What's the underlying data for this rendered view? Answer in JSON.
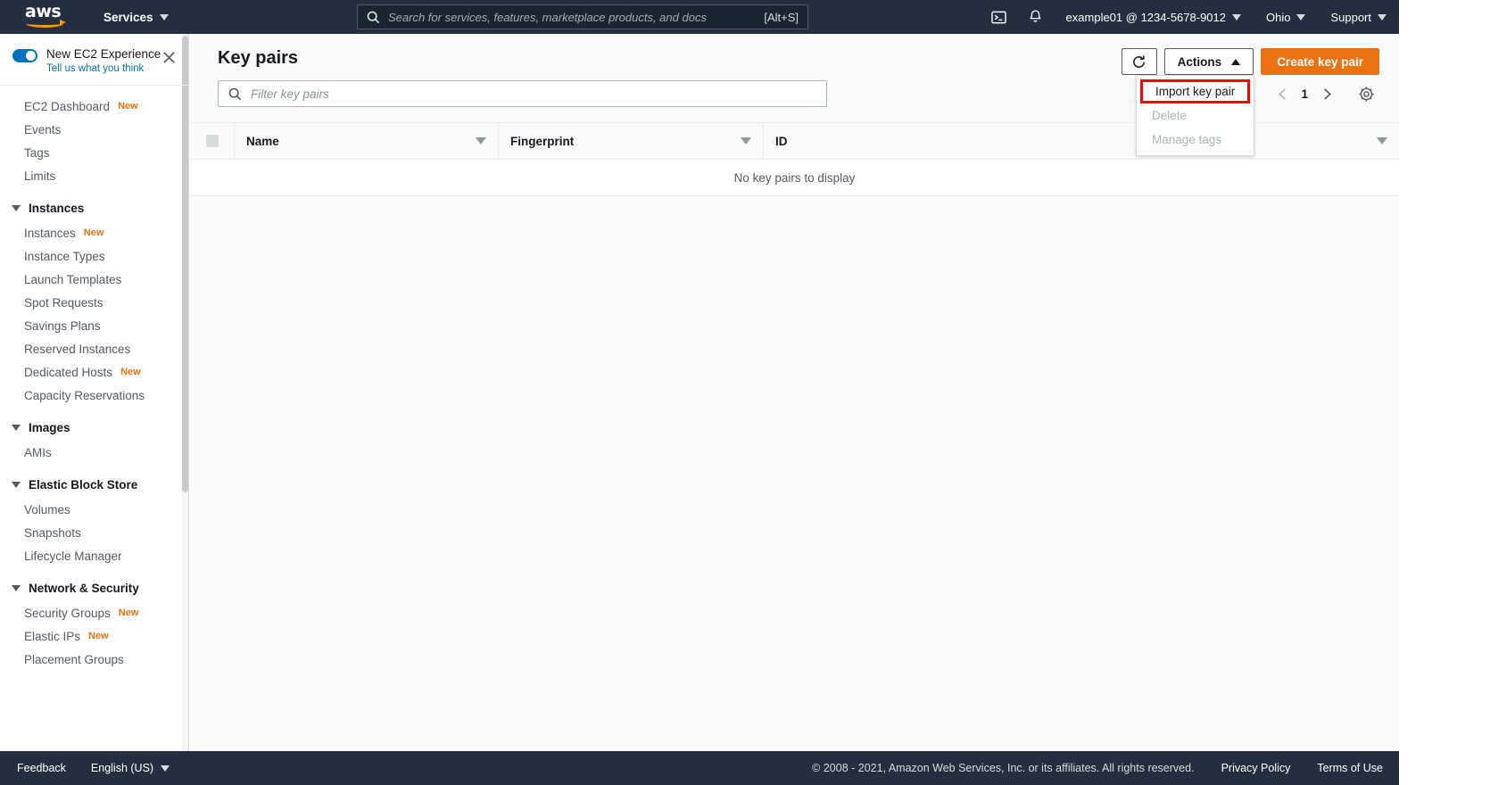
{
  "topnav": {
    "logo_text": "aws",
    "services_label": "Services",
    "search": {
      "placeholder": "Search for services, features, marketplace products, and docs",
      "shortcut": "[Alt+S]",
      "icon": "search-icon"
    },
    "cloudshell_icon": "terminal-icon",
    "bell_icon": "bell-icon",
    "account_label": "example01 @ 1234-5678-9012",
    "region_label": "Ohio",
    "support_label": "Support"
  },
  "sidebar": {
    "experience": {
      "title": "New EC2 Experience",
      "link": "Tell us what you think",
      "close_icon": "close-icon",
      "toggle_on": true
    },
    "top_items": [
      {
        "label": "EC2 Dashboard",
        "badge": "New"
      },
      {
        "label": "Events",
        "badge": ""
      },
      {
        "label": "Tags",
        "badge": ""
      },
      {
        "label": "Limits",
        "badge": ""
      }
    ],
    "groups": [
      {
        "title": "Instances",
        "items": [
          {
            "label": "Instances",
            "badge": "New"
          },
          {
            "label": "Instance Types",
            "badge": ""
          },
          {
            "label": "Launch Templates",
            "badge": ""
          },
          {
            "label": "Spot Requests",
            "badge": ""
          },
          {
            "label": "Savings Plans",
            "badge": ""
          },
          {
            "label": "Reserved Instances",
            "badge": ""
          },
          {
            "label": "Dedicated Hosts",
            "badge": "New"
          },
          {
            "label": "Capacity Reservations",
            "badge": ""
          }
        ]
      },
      {
        "title": "Images",
        "items": [
          {
            "label": "AMIs",
            "badge": ""
          }
        ]
      },
      {
        "title": "Elastic Block Store",
        "items": [
          {
            "label": "Volumes",
            "badge": ""
          },
          {
            "label": "Snapshots",
            "badge": ""
          },
          {
            "label": "Lifecycle Manager",
            "badge": ""
          }
        ]
      },
      {
        "title": "Network & Security",
        "items": [
          {
            "label": "Security Groups",
            "badge": "New"
          },
          {
            "label": "Elastic IPs",
            "badge": "New"
          },
          {
            "label": "Placement Groups",
            "badge": ""
          }
        ]
      }
    ]
  },
  "main": {
    "page_title": "Key pairs",
    "refresh_icon": "refresh-icon",
    "actions_label": "Actions",
    "create_label": "Create key pair",
    "dropdown": {
      "items": [
        {
          "label": "Import key pair",
          "disabled": false,
          "highlighted": true
        },
        {
          "label": "Delete",
          "disabled": true,
          "highlighted": false
        },
        {
          "label": "Manage tags",
          "disabled": true,
          "highlighted": false
        }
      ],
      "highlight_color": "#ff0000"
    },
    "filter": {
      "placeholder": "Filter key pairs",
      "value": "",
      "icon": "search-icon"
    },
    "pagination": {
      "prev_icon": "chevron-left-icon",
      "page": "1",
      "next_icon": "chevron-right-icon",
      "settings_icon": "gear-icon"
    },
    "table": {
      "columns": [
        "Name",
        "Fingerprint",
        "ID"
      ],
      "rows": [],
      "empty_text": "No key pairs to display"
    }
  },
  "footer": {
    "feedback_label": "Feedback",
    "language_label": "English (US)",
    "copyright": "© 2008 - 2021, Amazon Web Services, Inc. or its affiliates. All rights reserved.",
    "privacy_label": "Privacy Policy",
    "terms_label": "Terms of Use"
  },
  "colors": {
    "nav_bg": "#232f3e",
    "accent_orange": "#ec7211",
    "link_blue": "#0073bb",
    "highlight_red": "#ff0000"
  }
}
